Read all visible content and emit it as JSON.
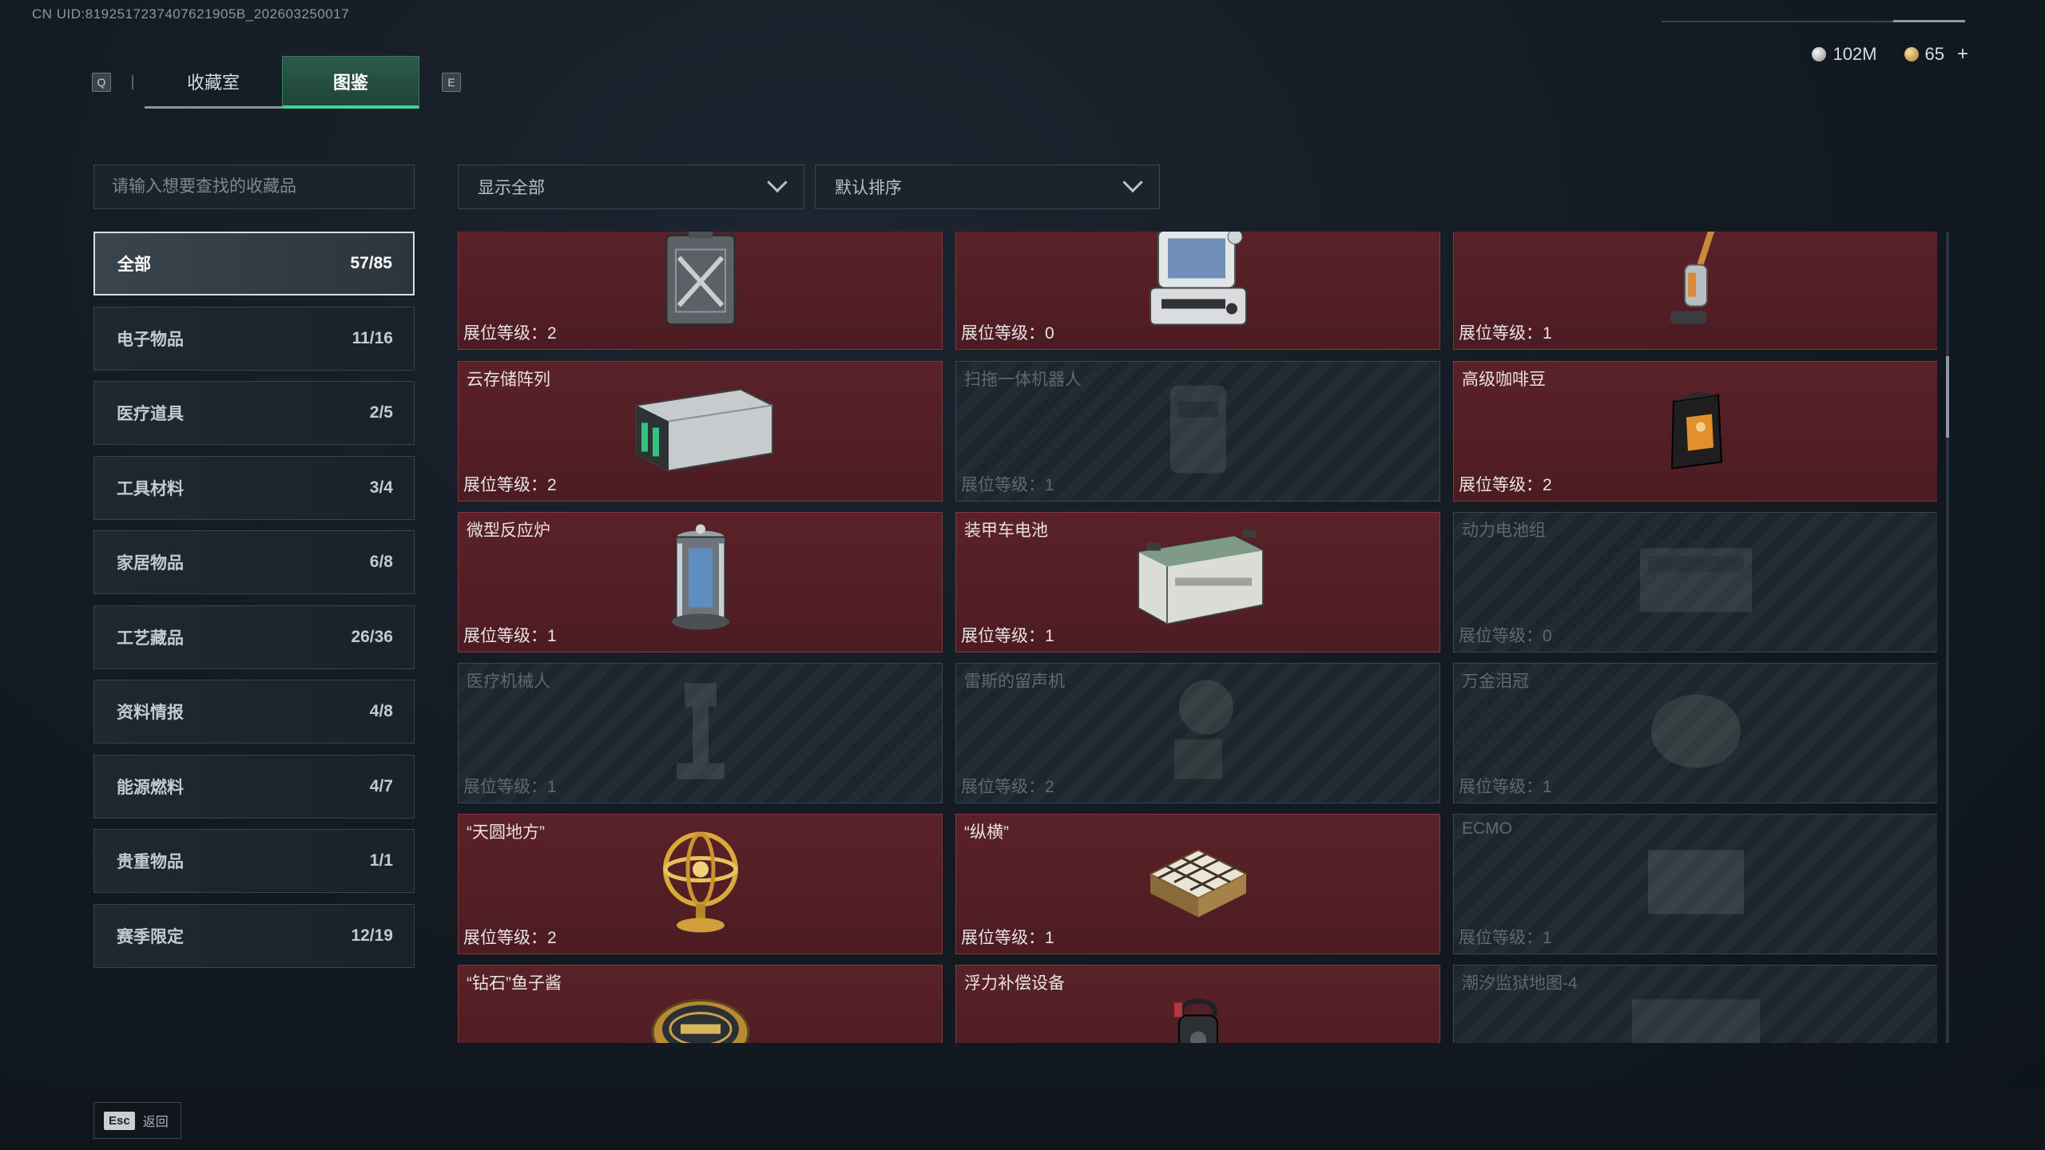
{
  "uid_text": "CN UID:8192517237407621905B_202603250017",
  "tabs": {
    "left_key": "Q",
    "right_key": "E",
    "items": [
      {
        "label": "收藏室",
        "active": false
      },
      {
        "label": "图鉴",
        "active": true
      }
    ]
  },
  "currency": {
    "silver_amount": "102M",
    "gold_amount": "65",
    "add_label": "+"
  },
  "search": {
    "placeholder": "请输入想要查找的收藏品"
  },
  "filters": {
    "show": "显示全部",
    "sort": "默认排序"
  },
  "categories": [
    {
      "label": "全部",
      "count": "57/85",
      "active": true
    },
    {
      "label": "电子物品",
      "count": "11/16"
    },
    {
      "label": "医疗道具",
      "count": "2/5"
    },
    {
      "label": "工具材料",
      "count": "3/4"
    },
    {
      "label": "家居物品",
      "count": "6/8"
    },
    {
      "label": "工艺藏品",
      "count": "26/36"
    },
    {
      "label": "资料情报",
      "count": "4/8"
    },
    {
      "label": "能源燃料",
      "count": "4/7"
    },
    {
      "label": "贵重物品",
      "count": "1/1"
    },
    {
      "label": "赛季限定",
      "count": "12/19"
    }
  ],
  "items": [
    {
      "name": "",
      "level": "展位等级：2",
      "locked": false,
      "icon": "fuel-can-icon"
    },
    {
      "name": "",
      "level": "展位等级：0",
      "locked": false,
      "icon": "computer-terminal-icon"
    },
    {
      "name": "",
      "level": "展位等级：1",
      "locked": false,
      "icon": "vacuum-cleaner-icon"
    },
    {
      "name": "云存储阵列",
      "level": "展位等级：2",
      "locked": false,
      "icon": "storage-array-icon"
    },
    {
      "name": "扫拖一体机器人",
      "level": "展位等级：1",
      "locked": true,
      "icon": "mop-robot-icon"
    },
    {
      "name": "高级咖啡豆",
      "level": "展位等级：2",
      "locked": false,
      "icon": "coffee-bag-icon"
    },
    {
      "name": "微型反应炉",
      "level": "展位等级：1",
      "locked": false,
      "icon": "reactor-icon"
    },
    {
      "name": "装甲车电池",
      "level": "展位等级：1",
      "locked": false,
      "icon": "battery-icon"
    },
    {
      "name": "动力电池组",
      "level": "展位等级：0",
      "locked": true,
      "icon": "battery-pack-icon"
    },
    {
      "name": "医疗机械人",
      "level": "展位等级：1",
      "locked": true,
      "icon": "medical-robot-icon"
    },
    {
      "name": "雷斯的留声机",
      "level": "展位等级：2",
      "locked": true,
      "icon": "gramophone-icon"
    },
    {
      "name": "万金泪冠",
      "level": "展位等级：1",
      "locked": true,
      "icon": "crown-icon"
    },
    {
      "name": "“天圆地方”",
      "level": "展位等级：2",
      "locked": false,
      "icon": "armillary-sphere-icon"
    },
    {
      "name": "“纵横”",
      "level": "展位等级：1",
      "locked": false,
      "icon": "chess-board-icon"
    },
    {
      "name": "ECMO",
      "level": "展位等级：1",
      "locked": true,
      "icon": "ecmo-icon"
    },
    {
      "name": "“钻石”鱼子酱",
      "level": "",
      "locked": false,
      "icon": "caviar-tin-icon"
    },
    {
      "name": "浮力补偿设备",
      "level": "",
      "locked": false,
      "icon": "buoyancy-device-icon"
    },
    {
      "name": "潮汐监狱地图-4",
      "level": "",
      "locked": true,
      "icon": "map-icon"
    }
  ],
  "footer": {
    "esc_key": "Esc",
    "back_label": "返回"
  },
  "colors": {
    "accent": "#3fd39c",
    "owned_card": "#5a2228",
    "locked_card": "#1d262e"
  }
}
